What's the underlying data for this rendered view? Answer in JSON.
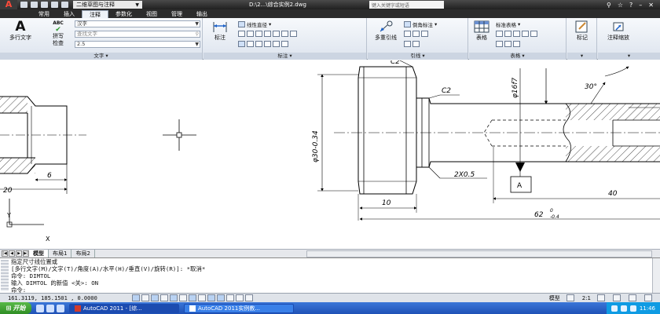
{
  "titlebar": {
    "app_button": "A",
    "workspace": "二维草图与注释",
    "file_title": "D:\\2...\\综合实例2.dwg",
    "search_placeholder": "键入关键字或短语"
  },
  "ribbon_tabs": [
    "常用",
    "插入",
    "注释",
    "参数化",
    "视图",
    "管理",
    "输出"
  ],
  "active_tab": "注释",
  "ribbon": {
    "text_panel": {
      "title": "文字",
      "mtext_label": "多行文字",
      "spell_label_1": "拼写",
      "spell_label_2": "检查",
      "spell_abc": "ABC",
      "style_value": "汉字",
      "find_placeholder": "查找文字",
      "height_value": "2.5"
    },
    "dim_panel": {
      "title": "标注",
      "dim_label": "标注",
      "linear_label": "线性直径"
    },
    "leader_panel": {
      "title": "引线",
      "multileader_label": "多重引线",
      "chamfer_label": "倒角标注"
    },
    "table_panel": {
      "title": "表格",
      "table_label": "表格",
      "style_value": "标准表格"
    },
    "mark_panel": {
      "mark_label": "标记"
    },
    "scale_panel": {
      "scale_label": "注释缩放"
    }
  },
  "drawing": {
    "label_c2_top": "C2",
    "label_c2": "C2",
    "label_phi16": "φ16f7",
    "label_30deg": "30°",
    "label_phi30": "φ30-0.34",
    "label_2x05": "2X0.5",
    "datum": "A",
    "dim_6": "6",
    "dim_20": "20",
    "dim_10": "10",
    "dim_40": "40",
    "dim_62": "62",
    "dim_62_upper": "0",
    "dim_62_lower": "-0.4",
    "ucs_y": "Y",
    "ucs_x": "X"
  },
  "layout_tabs": [
    "模型",
    "布局1",
    "布局2"
  ],
  "active_layout": "模型",
  "command_lines": [
    "指定尺寸线位置或",
    "[多行文字(M)/文字(T)/角度(A)/水平(H)/垂直(V)/旋转(R)]: *取消*",
    "命令: DIMTOL",
    "输入 DIMTOL 的新值 <关>: ON",
    "命令:"
  ],
  "statusbar": {
    "coords": "161.3119, 185.1501 , 0.0000",
    "model_label": "模型",
    "scale_label": "2:1"
  },
  "taskbar": {
    "start_label": "开始",
    "task1": "AutoCAD 2011 - [综...",
    "task2": "AutoCAD 2011实例教...",
    "clock": "11:46"
  }
}
